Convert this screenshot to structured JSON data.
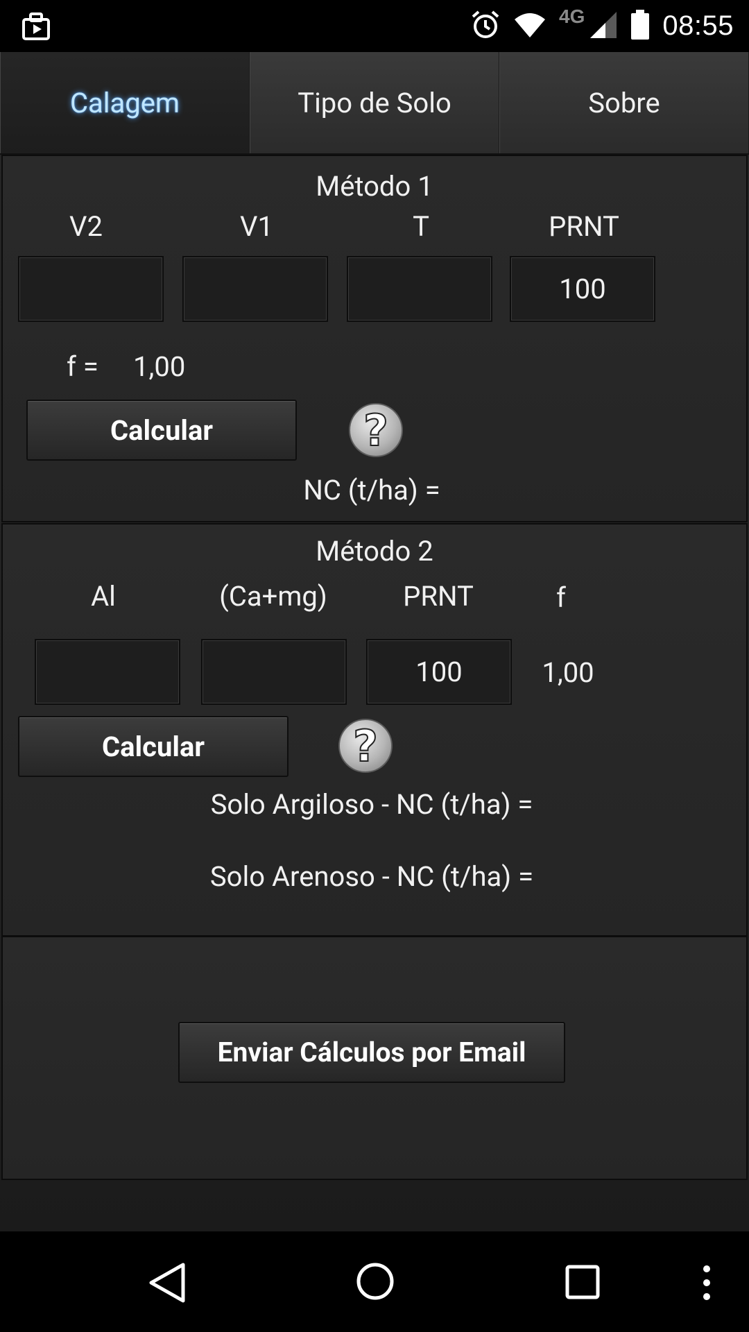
{
  "status_bar": {
    "network": "4G",
    "time": "08:55"
  },
  "tabs": [
    {
      "label": "Calagem"
    },
    {
      "label": "Tipo de Solo"
    },
    {
      "label": "Sobre"
    }
  ],
  "metodo1": {
    "title": "Método 1",
    "labels": [
      "V2",
      "V1",
      "T",
      "PRNT"
    ],
    "fields": [
      "",
      "",
      "",
      "100"
    ],
    "f_label": "f =",
    "f_value": "1,00",
    "calc_button": "Calcular",
    "result_label": "NC (t/ha) ="
  },
  "metodo2": {
    "title": "Método 2",
    "labels": [
      "Al",
      "(Ca+mg)",
      "PRNT",
      "f"
    ],
    "fields": [
      "",
      "",
      "100"
    ],
    "f_value": "1,00",
    "calc_button": "Calcular",
    "result_argiloso": "Solo Argiloso - NC (t/ha) =",
    "result_arenoso": "Solo Arenoso - NC (t/ha) ="
  },
  "email_button": "Enviar Cálculos por Email"
}
